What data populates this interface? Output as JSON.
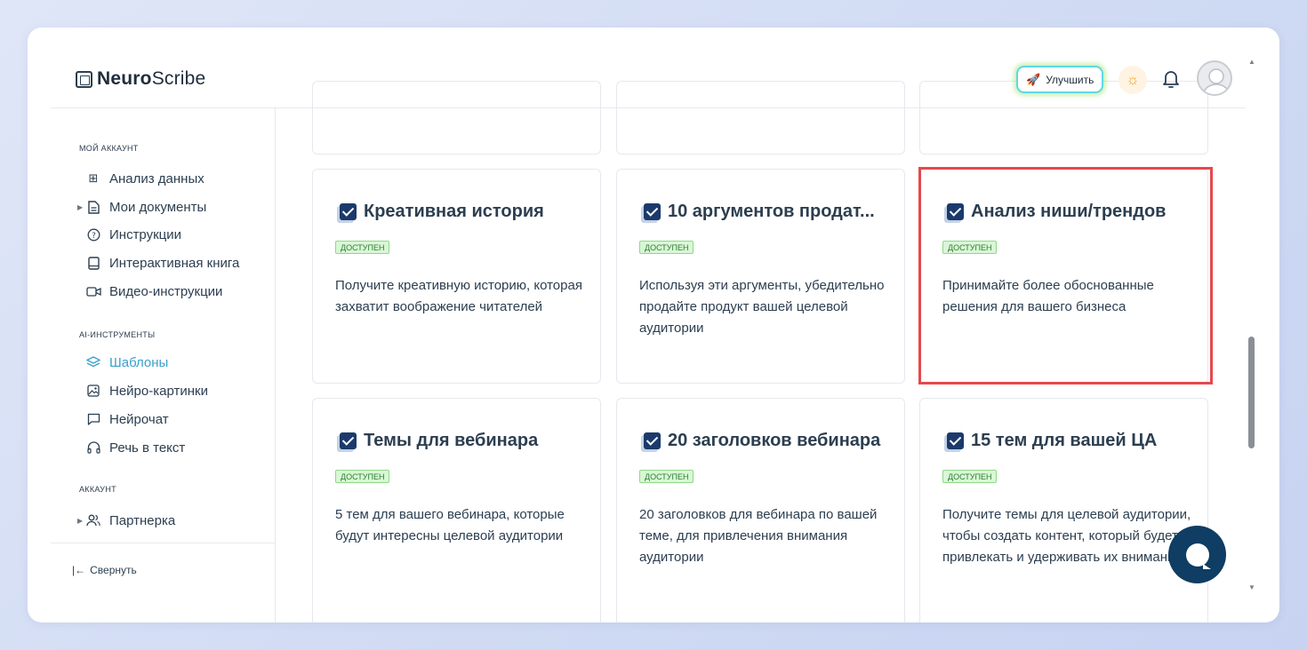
{
  "header": {
    "logo_bold": "Neuro",
    "logo_rest": "Scribe",
    "upgrade_label": "Улучшить"
  },
  "sidebar": {
    "sections": [
      {
        "label": "МОЙ АККАУНТ",
        "items": [
          {
            "label": "Анализ данных",
            "icon": "grid-icon"
          },
          {
            "label": "Мои документы",
            "icon": "document-icon",
            "expandable": true
          },
          {
            "label": "Инструкции",
            "icon": "help-circle-icon"
          },
          {
            "label": "Интерактивная книга",
            "icon": "book-icon"
          },
          {
            "label": "Видео-инструкции",
            "icon": "video-icon"
          }
        ]
      },
      {
        "label": "AI-ИНСТРУМЕНТЫ",
        "items": [
          {
            "label": "Шаблоны",
            "icon": "layers-icon",
            "active": true
          },
          {
            "label": "Нейро-картинки",
            "icon": "image-icon"
          },
          {
            "label": "Нейрочат",
            "icon": "chat-icon"
          },
          {
            "label": "Речь в текст",
            "icon": "headphones-icon"
          }
        ]
      },
      {
        "label": "АККАУНТ",
        "items": [
          {
            "label": "Партнерка",
            "icon": "users-icon",
            "expandable": true
          }
        ]
      }
    ],
    "collapse_label": "Свернуть"
  },
  "cards": [
    {
      "title": "Креативная история",
      "badge": "ДОСТУПЕН",
      "description": "Получите креативную историю, которая захватит воображение читателей"
    },
    {
      "title": "10 аргументов продат...",
      "badge": "ДОСТУПЕН",
      "description": "Используя эти аргументы, убедительно продайте продукт вашей целевой аудитории"
    },
    {
      "title": "Анализ ниши/трендов",
      "badge": "ДОСТУПЕН",
      "description": "Принимайте более обоснованные решения для вашего бизнеса",
      "highlighted": true
    },
    {
      "title": "Темы для вебинара",
      "badge": "ДОСТУПЕН",
      "description": "5 тем для вашего вебинара, которые будут интересны целевой аудитории"
    },
    {
      "title": "20 заголовков вебинара",
      "badge": "ДОСТУПЕН",
      "description": "20 заголовков для вебинара по вашей теме, для привлечения внимания аудитории"
    },
    {
      "title": "15 тем для вашей ЦА",
      "badge": "ДОСТУПЕН",
      "description": "Получите темы для целевой аудитории, чтобы создать контент, который будет привлекать и удерживать их внимание"
    }
  ],
  "colors": {
    "accent": "#3aa0c9",
    "highlight": "#e5484d",
    "badge_bg": "#d9f7d6",
    "chat_fab": "#0f3d63"
  }
}
